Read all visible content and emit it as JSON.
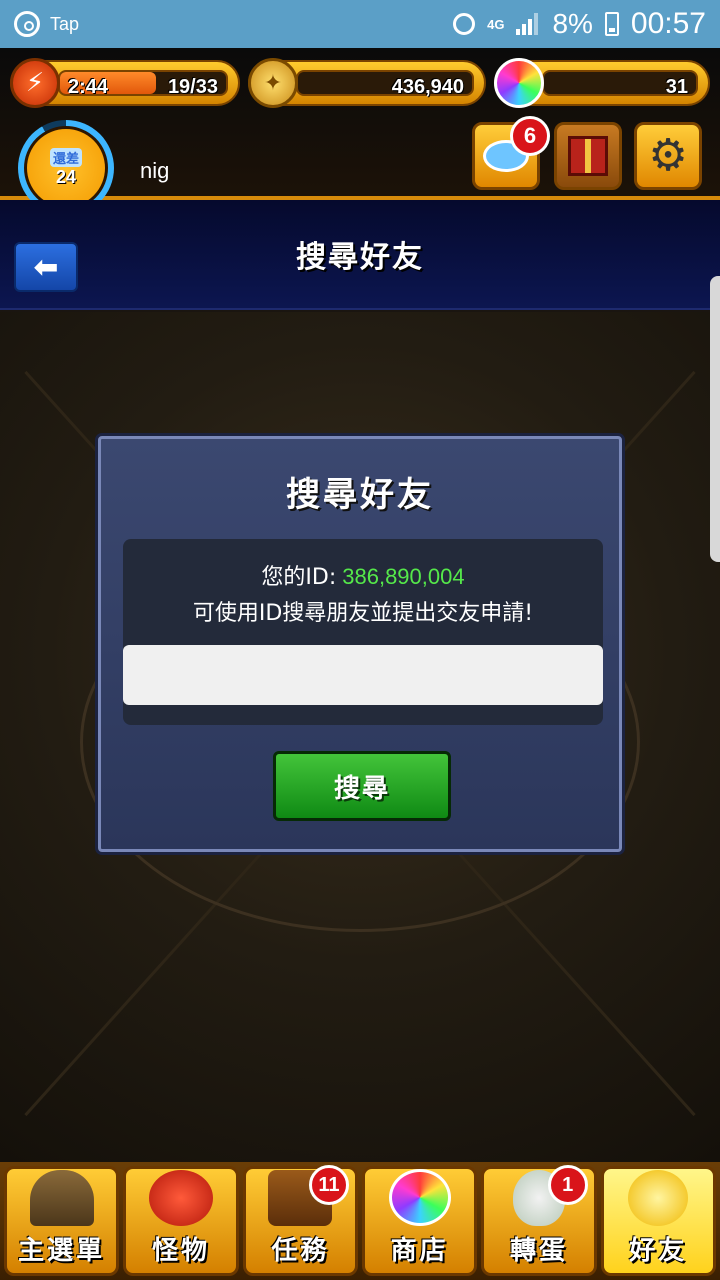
{
  "status_bar": {
    "app_name": "Tap",
    "network": "4G",
    "battery_percent": "8%",
    "time": "00:57"
  },
  "hud": {
    "stamina_timer": "2:44",
    "stamina": "19/33",
    "stamina_fraction": 0.576,
    "coins": "436,940",
    "orbs": "31",
    "level_label": "還差",
    "level_value": "24",
    "player_name": "nig",
    "chat_badge": "6"
  },
  "header": {
    "title": "搜尋好友"
  },
  "dialog": {
    "title": "搜尋好友",
    "id_label": "您的ID:",
    "id_value": "386,890,004",
    "hint": "可使用ID搜尋朋友並提出交友申請!",
    "input_value": "",
    "search_button": "搜尋"
  },
  "bottom_nav": {
    "items": [
      {
        "label": "主選單",
        "icon": "gate-icon",
        "badge": ""
      },
      {
        "label": "怪物",
        "icon": "monster-icon",
        "badge": ""
      },
      {
        "label": "任務",
        "icon": "quest-book-icon",
        "badge": "11"
      },
      {
        "label": "商店",
        "icon": "rainbow-orb-icon",
        "badge": ""
      },
      {
        "label": "轉蛋",
        "icon": "egg-icon",
        "badge": "1"
      },
      {
        "label": "好友",
        "icon": "friends-icon",
        "badge": ""
      }
    ]
  }
}
